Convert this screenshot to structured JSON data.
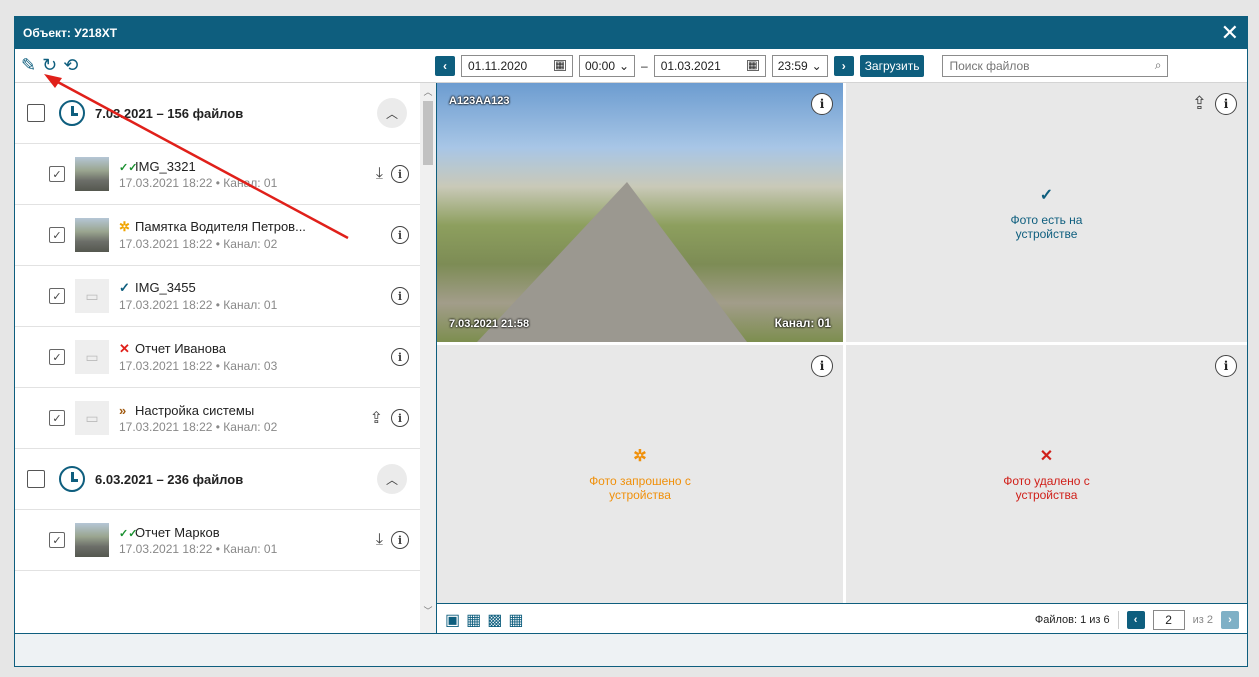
{
  "window": {
    "title": "Объект: У218ХТ",
    "close_label": "✕"
  },
  "toolbar": {
    "date_from": "01.11.2020",
    "time_from": "00:00",
    "dash": "–",
    "date_to": "01.03.2021",
    "time_to": "23:59",
    "load_label": "Загрузить",
    "search_placeholder": "Поиск файлов"
  },
  "groups": [
    {
      "title": "7.03.2021 – 156 файлов"
    },
    {
      "title": "6.03.2021 – 236 файлов"
    }
  ],
  "files": [
    {
      "name": "IMG_3321",
      "meta": "17.03.2021 18:22 • Канал: 01",
      "status": "✓✓",
      "status_color": "#1a9030",
      "thumb": "photo",
      "actions": [
        "download-icon",
        "info-icon"
      ]
    },
    {
      "name": "Памятка Водителя Петров...",
      "meta": "17.03.2021 18:22 • Канал: 02",
      "status": "✲",
      "status_color": "#f0a400",
      "thumb": "photo",
      "actions": [
        "info-icon"
      ]
    },
    {
      "name": "IMG_3455",
      "meta": "17.03.2021 18:22 • Канал: 01",
      "status": "✓",
      "status_color": "#0e5e7e",
      "thumb": "placeholder",
      "actions": [
        "info-icon"
      ]
    },
    {
      "name": "Отчет Иванова",
      "meta": "17.03.2021 18:22 • Канал: 03",
      "status": "✕",
      "status_color": "#e0201a",
      "thumb": "placeholder",
      "actions": [
        "info-icon"
      ]
    },
    {
      "name": "Настройка системы",
      "meta": "17.03.2021 18:22 • Канал: 02",
      "status": "»",
      "status_color": "#a05a10",
      "thumb": "placeholder",
      "actions": [
        "upload-icon",
        "info-icon"
      ]
    },
    {
      "name": "Отчет Марков",
      "meta": "17.03.2021 18:22 • Канал: 01",
      "status": "✓✓",
      "status_color": "#1a9030",
      "thumb": "photo",
      "actions": [
        "download-icon",
        "info-icon"
      ]
    }
  ],
  "viewer": {
    "photo": {
      "plate": "А123АА123",
      "timestamp": "7.03.2021 21:58",
      "channel": "Канал: 01"
    },
    "cell_on_device": {
      "icon": "✓",
      "text": "Фото есть на устройстве"
    },
    "cell_requested": {
      "icon": "✲",
      "text": "Фото запрошено с устройства"
    },
    "cell_deleted": {
      "icon": "✕",
      "text": "Фото удалено с устройства"
    }
  },
  "pager": {
    "files_label": "Файлов: 1 из 6",
    "page": "2",
    "of_label": "из 2"
  },
  "colors": {
    "accent": "#0e5e7e",
    "annotation_arrow": "#e0201a"
  }
}
